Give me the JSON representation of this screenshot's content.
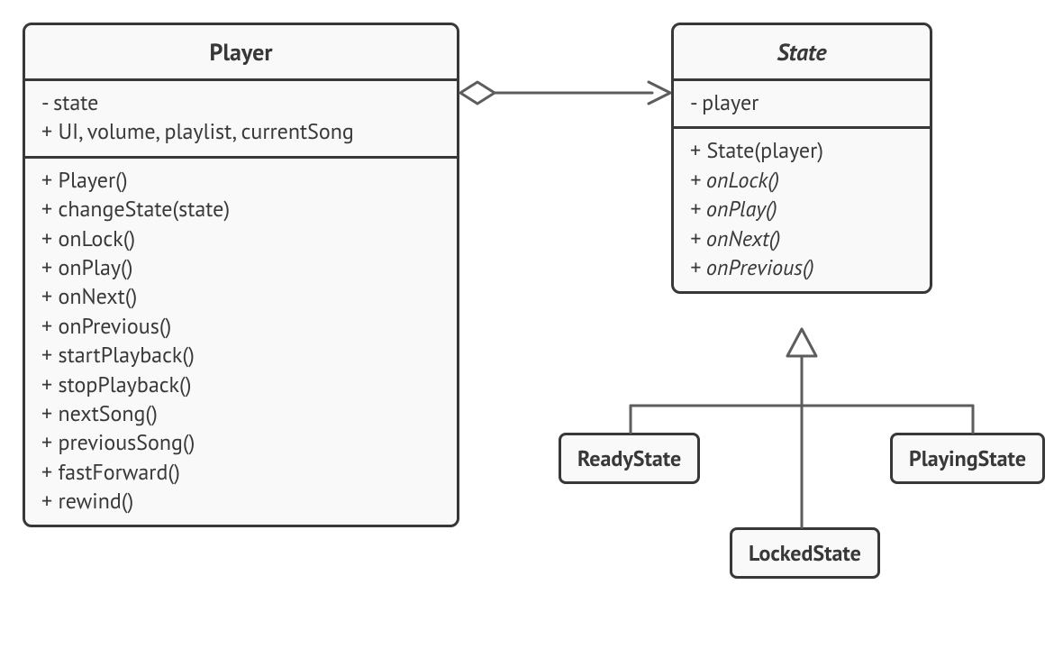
{
  "player": {
    "title": "Player",
    "attrs": [
      "- state",
      "+ UI, volume, playlist, currentSong"
    ],
    "methods": [
      "+ Player()",
      "+ changeState(state)",
      "+ onLock()",
      "+ onPlay()",
      "+ onNext()",
      "+ onPrevious()",
      "+ startPlayback()",
      "+ stopPlayback()",
      "+ nextSong()",
      "+ previousSong()",
      "+ fastForward()",
      "+ rewind()"
    ]
  },
  "state": {
    "title": "State",
    "attrs": [
      "- player"
    ],
    "methods": [
      {
        "text": "+ State(player)",
        "italic": false
      },
      {
        "text": "+ onLock()",
        "italic": true
      },
      {
        "text": "+ onPlay()",
        "italic": true
      },
      {
        "text": "+ onNext()",
        "italic": true
      },
      {
        "text": "+ onPrevious()",
        "italic": true
      }
    ]
  },
  "subclasses": {
    "ready": "ReadyState",
    "locked": "LockedState",
    "playing": "PlayingState"
  }
}
